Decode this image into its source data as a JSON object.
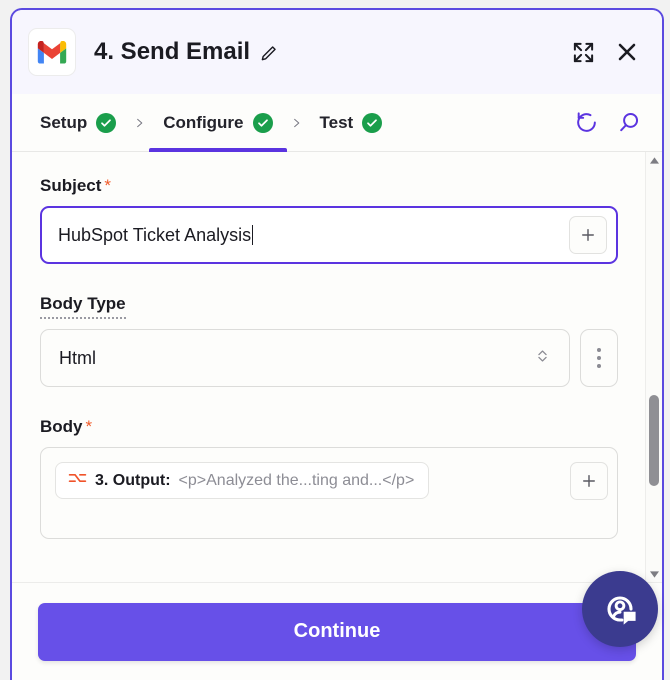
{
  "version_string": "ver. 2024-09-03T16:23-15806b",
  "colors": {
    "accent_purple": "#5b34e0",
    "button_purple": "#6750e8",
    "success_green": "#1a9e4b",
    "required_orange": "#f05a28",
    "token_icon_orange": "#f0532a",
    "fab_navy": "#3b3b8f"
  },
  "header": {
    "app_icon": "gmail-icon",
    "title": "4. Send Email",
    "edit_icon": "pencil-icon",
    "expand_icon": "expand-icon",
    "close_icon": "close-icon"
  },
  "tabs": {
    "items": [
      {
        "label": "Setup",
        "status_icon": "check-circle-icon",
        "active": false
      },
      {
        "label": "Configure",
        "status_icon": "check-circle-icon",
        "active": true
      },
      {
        "label": "Test",
        "status_icon": "check-circle-icon",
        "active": false
      }
    ],
    "separator": "›",
    "actions": [
      {
        "name": "refresh-icon"
      },
      {
        "name": "search-icon"
      }
    ]
  },
  "form": {
    "subject": {
      "label": "Subject",
      "required_marker": "*",
      "value": "HubSpot Ticket Analysis",
      "placeholder": "",
      "add_button_icon": "plus-icon"
    },
    "body_type": {
      "label": "Body Type",
      "value": "Html",
      "chevron_icon": "chevron-updown-icon",
      "kebab_icon": "more-vertical-icon"
    },
    "body": {
      "label": "Body",
      "required_marker": "*",
      "token": {
        "icon": "transform-icon",
        "label": "3. Output:",
        "preview": "<p>Analyzed the...ting and...</p>"
      },
      "add_button_icon": "plus-icon"
    }
  },
  "scrollbar": {
    "up_arrow_icon": "caret-up-icon",
    "down_arrow_icon": "caret-down-icon"
  },
  "footer": {
    "continue_label": "Continue"
  },
  "support": {
    "icon": "support-chat-icon"
  }
}
